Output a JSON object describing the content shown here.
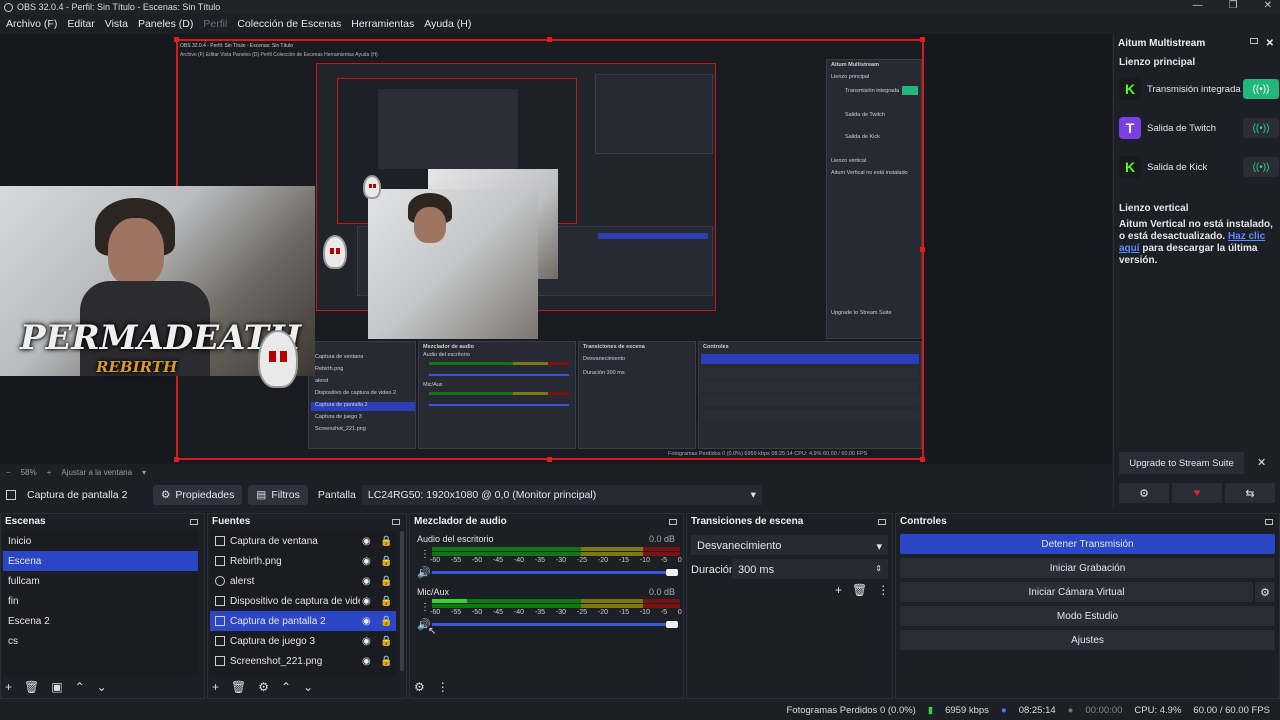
{
  "title": "OBS 32.0.4 - Perfil: Sin Título - Escenas: Sin Título",
  "menu": [
    "Archivo (F)",
    "Editar",
    "Vista",
    "Paneles (D)",
    "Perfil",
    "Colección de Escenas",
    "Herramientas",
    "Ayuda (H)"
  ],
  "preview": {
    "overlay_title": "PERMADEATH",
    "overlay_subtitle": "REBIRTH",
    "zoom": "58%",
    "fit_label": "Ajustar a la ventana"
  },
  "source_bar": {
    "current_source": "Captura de pantalla 2",
    "properties": "Propiedades",
    "filters": "Filtros",
    "screen_label": "Pantalla",
    "monitor": "LC24RG50: 1920x1080 @ 0,0 (Monitor principal)"
  },
  "scenes": {
    "title": "Escenas",
    "items": [
      "Inicio",
      "Escena",
      "fullcam",
      "fin",
      "Escena 2",
      "cs"
    ],
    "selected": 1
  },
  "sources": {
    "title": "Fuentes",
    "items": [
      "Captura de ventana",
      "Rebirth.png",
      "alerst",
      "Dispositivo de captura de video 2",
      "Captura de pantalla 2",
      "Captura de juego 3",
      "Screenshot_221.png"
    ],
    "selected": 4
  },
  "mixer": {
    "title": "Mezclador de audio",
    "channels": [
      {
        "name": "Audio del escritorio",
        "db": "0.0 dB",
        "level": 0.0,
        "volume": 1.0
      },
      {
        "name": "Mic/Aux",
        "db": "0.0 dB",
        "level": 0.14,
        "volume": 1.0
      }
    ],
    "scale": [
      "-60",
      "-55",
      "-50",
      "-45",
      "-40",
      "-35",
      "-30",
      "-25",
      "-20",
      "-15",
      "-10",
      "-5",
      "0"
    ]
  },
  "transitions": {
    "title": "Transiciones de escena",
    "selected": "Desvanecimiento",
    "duration_label": "Duración",
    "duration": "300 ms"
  },
  "controls": {
    "title": "Controles",
    "buttons": [
      "Detener Transmisión",
      "Iniciar Grabación",
      "Iniciar Cámara Virtual",
      "Modo Estudio",
      "Ajustes"
    ]
  },
  "aitum": {
    "title": "Aitum Multistream",
    "main_canvas": "Lienzo principal",
    "outputs": [
      {
        "label": "Transmisión integrada",
        "color": "#1a1a1a",
        "glyph": "K",
        "on": true
      },
      {
        "label": "Salida de Twitch",
        "color": "#7b3fe4",
        "glyph": "T",
        "on": false
      },
      {
        "label": "Salida de Kick",
        "color": "#1a1a1a",
        "glyph": "K",
        "on": false
      }
    ],
    "vertical_canvas": "Lienzo vertical",
    "vertical_msg": "Aitum Vertical no está instalado, o está desactualizado.",
    "vertical_link": "Haz clic aquí",
    "vertical_rest": "para descargar la última versión.",
    "upgrade": "Upgrade to Stream Suite"
  },
  "status": {
    "dropped": "Fotogramas Perdidos 0 (0.0%)",
    "bitrate": "6959 kbps",
    "live_time": "08:25:14",
    "rec_time": "00:00:00",
    "cpu": "CPU: 4.9%",
    "fps": "60.00 / 60.00 FPS"
  },
  "colors": {
    "accent": "#2c47c6",
    "selection_red": "#d21b1b",
    "kick_green": "#53fc18"
  }
}
